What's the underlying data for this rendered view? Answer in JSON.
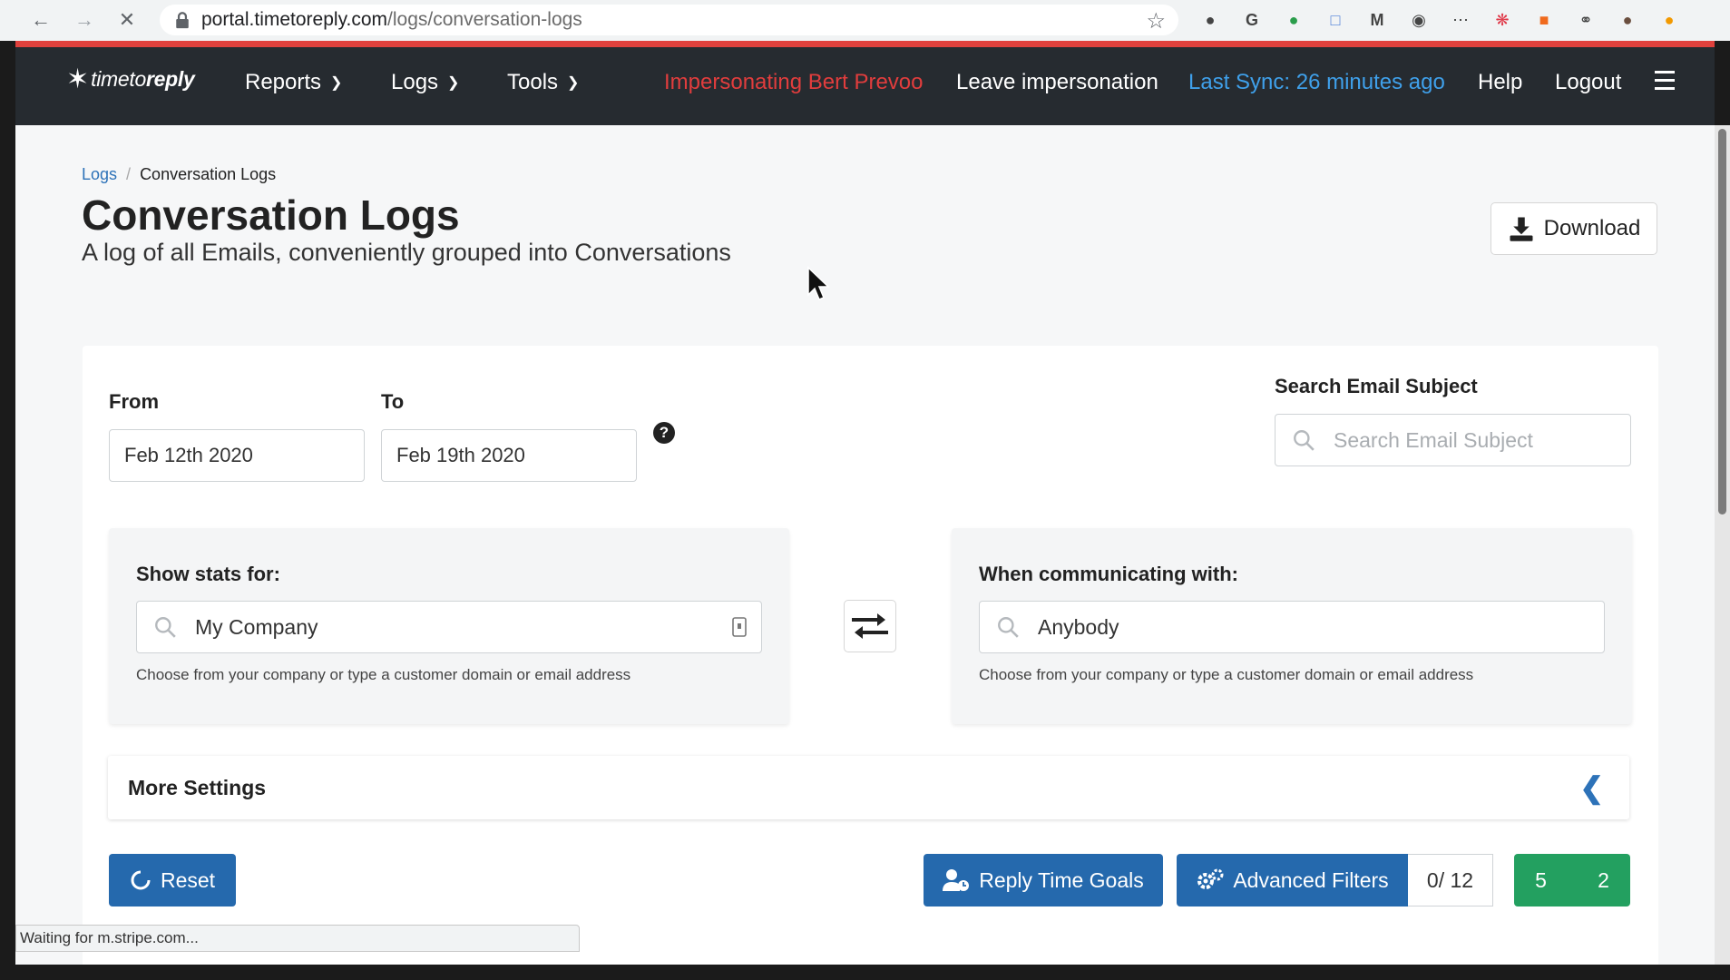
{
  "browser": {
    "url_host": "portal.timetoreply.com",
    "url_path": "/logs/conversation-logs",
    "status_text": "Waiting for m.stripe.com..."
  },
  "nav": {
    "logo_text_prefix": "timeto",
    "logo_text_suffix": "reply",
    "items": [
      {
        "label": "Reports"
      },
      {
        "label": "Logs"
      },
      {
        "label": "Tools"
      }
    ],
    "impersonating": "Impersonating Bert Prevoo",
    "leave": "Leave impersonation",
    "last_sync": "Last Sync: 26 minutes ago",
    "help": "Help",
    "logout": "Logout"
  },
  "breadcrumb": {
    "parent": "Logs",
    "current": "Conversation Logs"
  },
  "page": {
    "title": "Conversation Logs",
    "subtitle": "A log of all Emails, conveniently grouped into Conversations",
    "download_label": "Download"
  },
  "filters": {
    "from_label": "From",
    "from_value": "Feb 12th 2020",
    "to_label": "To",
    "to_value": "Feb 19th 2020",
    "search_label": "Search Email Subject",
    "search_placeholder": "Search Email Subject",
    "show_stats_label": "Show stats for:",
    "show_stats_value": "My Company",
    "show_stats_hint": "Choose from your company or type a customer domain or email address",
    "communicating_label": "When communicating with:",
    "communicating_value": "Anybody",
    "communicating_hint": "Choose from your company or type a customer domain or email address",
    "more_settings": "More Settings"
  },
  "actions": {
    "reset": "Reset",
    "reply_time_goals": "Reply Time Goals",
    "advanced_filters": "Advanced Filters",
    "filter_count": "0/ 12",
    "green_a": "5",
    "green_b": "2"
  },
  "colors": {
    "nav_bg": "#262b30",
    "primary_blue": "#2569ad",
    "success_green": "#23a060",
    "warning_red": "#e13d3d",
    "sync_blue": "#3fa0ea",
    "loading_bar": "#e0413d"
  }
}
